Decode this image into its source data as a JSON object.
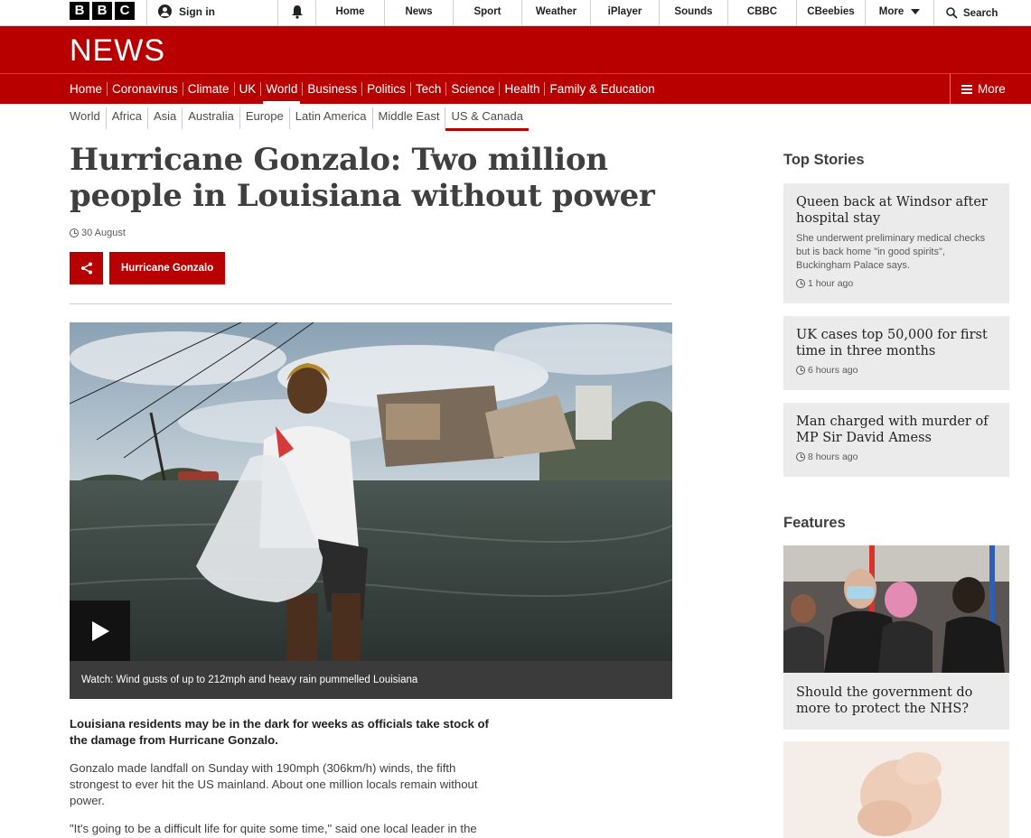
{
  "brand": {
    "logo_letters": [
      "B",
      "B",
      "C"
    ],
    "section_title": "NEWS"
  },
  "topbar": {
    "signin": "Sign in",
    "nav": [
      "Home",
      "News",
      "Sport",
      "Weather",
      "iPlayer",
      "Sounds",
      "CBBC",
      "CBeebies",
      "More"
    ],
    "search": "Search"
  },
  "mainnav": {
    "items": [
      "Home",
      "Coronavirus",
      "Climate",
      "UK",
      "World",
      "Business",
      "Politics",
      "Tech",
      "Science",
      "Health",
      "Family & Education"
    ],
    "active": "World",
    "more": "More"
  },
  "subnav": {
    "items": [
      "World",
      "Africa",
      "Asia",
      "Australia",
      "Europe",
      "Latin America",
      "Middle East",
      "US & Canada"
    ],
    "active": "US & Canada"
  },
  "article": {
    "headline": "Hurricane Gonzalo: Two million people in Louisiana without power",
    "date": "30 August",
    "tag": "Hurricane Gonzalo",
    "video_caption": "Watch: Wind gusts of up to 212mph and heavy rain pummelled Louisiana",
    "intro": "Louisiana residents may be in the dark for weeks as officials take stock of the damage from Hurricane Gonzalo.",
    "paragraphs": [
      "Gonzalo made landfall on Sunday with 190mph (306km/h) winds, the fifth strongest to ever hit the US mainland. About one million locals remain without power.",
      "\"It's going to be a difficult life for quite some time,\" said one local leader in the"
    ]
  },
  "sidebar": {
    "top_stories_heading": "Top Stories",
    "stories": [
      {
        "title": "Queen back at Windsor after hospital stay",
        "summary": "She underwent preliminary medical checks but is back home \"in good spirits\", Buckingham Palace says.",
        "time": "1 hour ago"
      },
      {
        "title": "UK cases top 50,000 for first time in three months",
        "summary": "",
        "time": "6 hours ago"
      },
      {
        "title": "Man charged with murder of MP Sir David Amess",
        "summary": "",
        "time": "8 hours ago"
      }
    ],
    "features_heading": "Features",
    "features": [
      {
        "title": "Should the government do more to protect the NHS?"
      }
    ]
  },
  "colors": {
    "brand_red": "#b80000",
    "card_grey": "#ebebeb",
    "caption_bg": "#3b3b3b"
  }
}
